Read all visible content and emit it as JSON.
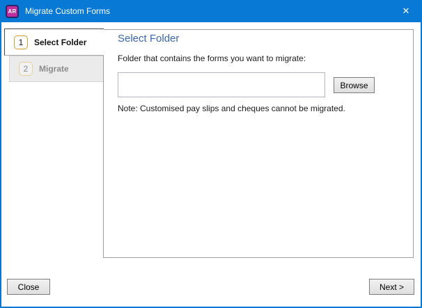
{
  "window": {
    "title": "Migrate Custom Forms",
    "app_icon_text": "AR",
    "close_icon": "✕",
    "accent_color": "#0879d4"
  },
  "wizard": {
    "steps": [
      {
        "number": "1",
        "label": "Select Folder",
        "active": true
      },
      {
        "number": "2",
        "label": "Migrate",
        "active": false
      }
    ]
  },
  "main": {
    "heading": "Select Folder",
    "heading_color": "#3a67ad",
    "folder_label": "Folder that contains the forms you want to migrate:",
    "folder_input_value": "",
    "browse_button": "Browse",
    "note": "Note: Customised pay slips and cheques cannot be migrated."
  },
  "footer": {
    "close_button": "Close",
    "next_button": "Next >"
  }
}
